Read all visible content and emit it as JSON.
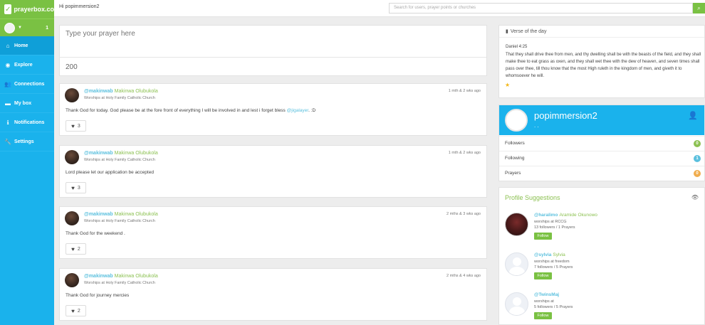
{
  "brand": {
    "name": "prayerbox.co"
  },
  "userbar": {
    "badge": "1"
  },
  "nav": [
    {
      "label": "Home",
      "icon": "home-icon"
    },
    {
      "label": "Explore",
      "icon": "compass-icon"
    },
    {
      "label": "Connections",
      "icon": "users-icon"
    },
    {
      "label": "My box",
      "icon": "box-icon"
    },
    {
      "label": "Notifications",
      "icon": "info-icon"
    },
    {
      "label": "Settings",
      "icon": "wrench-icon"
    }
  ],
  "topbar": {
    "greeting": "Hi popimmersion2",
    "search_placeholder": "Search for users, prayer points or churches"
  },
  "compose": {
    "placeholder": "Type your prayer here",
    "char_count": "200"
  },
  "posts": [
    {
      "handle": "@makinwab",
      "fullname": "Makinwa Olubukola",
      "church": "Worships at Holy Family Catholic Church",
      "time": "1 mth & 2 wks ago",
      "body": "Thank God for today. God please be at the fore front of everything I will be involved in and lest i forget bless ",
      "mention": "@jigalayer",
      "body_suffix": ". :D",
      "likes": "3"
    },
    {
      "handle": "@makinwab",
      "fullname": "Makinwa Olubukola",
      "church": "Worships at Holy Family Catholic Church",
      "time": "1 mth & 2 wks ago",
      "body": "Lord please let our application be accepted",
      "likes": "3"
    },
    {
      "handle": "@makinwab",
      "fullname": "Makinwa Olubukola",
      "church": "Worships at Holy Family Catholic Church",
      "time": "2 mths & 3 wks ago",
      "body": "Thank God for the weekend .",
      "likes": "2"
    },
    {
      "handle": "@makinwab",
      "fullname": "Makinwa Olubukola",
      "church": "Worships at Holy Family Catholic Church",
      "time": "2 mths & 4 wks ago",
      "body": "Thank God for journey mercies",
      "likes": "2"
    }
  ],
  "verse": {
    "header": "Verse of the day",
    "reference": "Daniel 4:25",
    "text": "That they shall drive thee from men, and thy dwelling shall be with the beasts of the field, and they shall make thee to eat grass as oxen, and they shall wet thee with the dew of heaven, and seven times shall pass over thee, till thou know that the most High ruleth in the kingdom of men, and giveth it to whomsoever he will."
  },
  "profile": {
    "name": "popimmersion2",
    "subtitle": ". .",
    "stats": [
      {
        "label": "Followers",
        "count": "0",
        "color": "#8cc152"
      },
      {
        "label": "Following",
        "count": "1",
        "color": "#5bc0de"
      },
      {
        "label": "Prayers",
        "count": "0",
        "color": "#f0ad4e"
      }
    ]
  },
  "suggestions": {
    "title": "Profile Suggestions",
    "items": [
      {
        "handle": "@haralimo",
        "fullname": "Aramide Okunowo",
        "worships": "worships at RCCG",
        "stats": "13 followers / 1 Prayers",
        "follow_label": "Follow"
      },
      {
        "handle": "@sylvia",
        "fullname": "Sylvia",
        "worships": "worships at freedom",
        "stats": "7 followers / 5 Prayers",
        "follow_label": "Follow"
      },
      {
        "handle": "@TwinsMaj",
        "fullname": "",
        "worships": "worships at",
        "stats": "5 followers / 5 Prayers",
        "follow_label": "Follow"
      }
    ]
  }
}
